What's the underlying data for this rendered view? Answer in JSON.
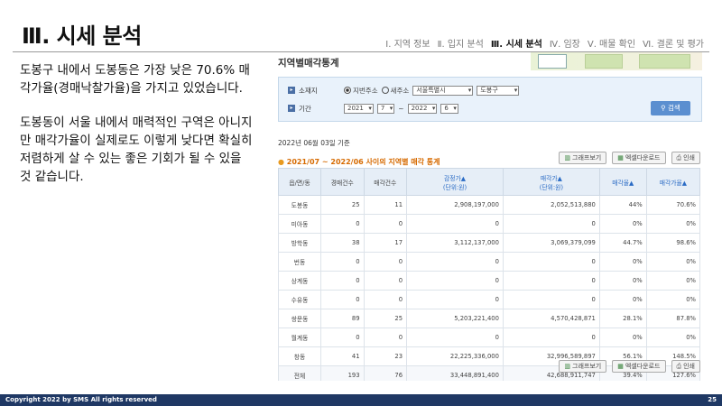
{
  "slide": {
    "title": "Ⅲ. 시세 분석",
    "nav": [
      "Ⅰ. 지역 정보",
      "Ⅱ. 입지 분석",
      "Ⅲ. 시세 분석",
      "Ⅳ. 임장",
      "Ⅴ. 매물 확인",
      "Ⅵ. 결론 및 평가"
    ],
    "active_nav": "Ⅲ. 시세 분석",
    "paragraphs": [
      "도봉구 내에서 도봉동은 가장 낮은 70.6% 매각가율(경매낙찰가율)을 가지고 있었습니다.",
      "도봉동이 서울 내에서 매력적인 구역은 아니지만 매각가율이 실제로도 이렇게 낮다면 확실히 저렴하게 살 수 있는 좋은 기회가 될 수 있을 것 같습니다."
    ],
    "footer_text": "Copyright 2022 by SMS All rights reserved",
    "page_number": "25"
  },
  "screenshot": {
    "title": "지역별매각통계",
    "search": {
      "location_label": "소재지",
      "radio_lot": "지번주소",
      "radio_road": "새주소",
      "city": "서울특별시",
      "district": "도봉구",
      "period_label": "기간",
      "from_year": "2021",
      "from_month": "7",
      "tilde": "~",
      "to_year": "2022",
      "to_month": "6",
      "search_button": "검색"
    },
    "date": "2022년 06월 03일 기준",
    "section_title": "2021/07 ~ 2022/06 사이의 지역별 매각 통계",
    "buttons": {
      "graph": "그래프보기",
      "excel": "엑셀다운로드",
      "print": "인쇄"
    },
    "columns": [
      "읍/면/동",
      "경매건수",
      "매각건수",
      "감정가▲\n(단위:원)",
      "매각가▲\n(단위:원)",
      "매각율▲",
      "매각가율▲"
    ],
    "rows": [
      [
        "도봉동",
        "25",
        "11",
        "2,908,197,000",
        "2,052,513,880",
        "44%",
        "70.6%"
      ],
      [
        "미아동",
        "0",
        "0",
        "0",
        "0",
        "0%",
        "0%"
      ],
      [
        "방학동",
        "38",
        "17",
        "3,112,137,000",
        "3,069,379,099",
        "44.7%",
        "98.6%"
      ],
      [
        "번동",
        "0",
        "0",
        "0",
        "0",
        "0%",
        "0%"
      ],
      [
        "상계동",
        "0",
        "0",
        "0",
        "0",
        "0%",
        "0%"
      ],
      [
        "수유동",
        "0",
        "0",
        "0",
        "0",
        "0%",
        "0%"
      ],
      [
        "쌍문동",
        "89",
        "25",
        "5,203,221,400",
        "4,570,428,871",
        "28.1%",
        "87.8%"
      ],
      [
        "월계동",
        "0",
        "0",
        "0",
        "0",
        "0%",
        "0%"
      ],
      [
        "창동",
        "41",
        "23",
        "22,225,336,000",
        "32,996,589,897",
        "56.1%",
        "148.5%"
      ],
      [
        "전체",
        "193",
        "76",
        "33,448,891,400",
        "42,688,911,747",
        "39.4%",
        "127.6%"
      ]
    ]
  }
}
